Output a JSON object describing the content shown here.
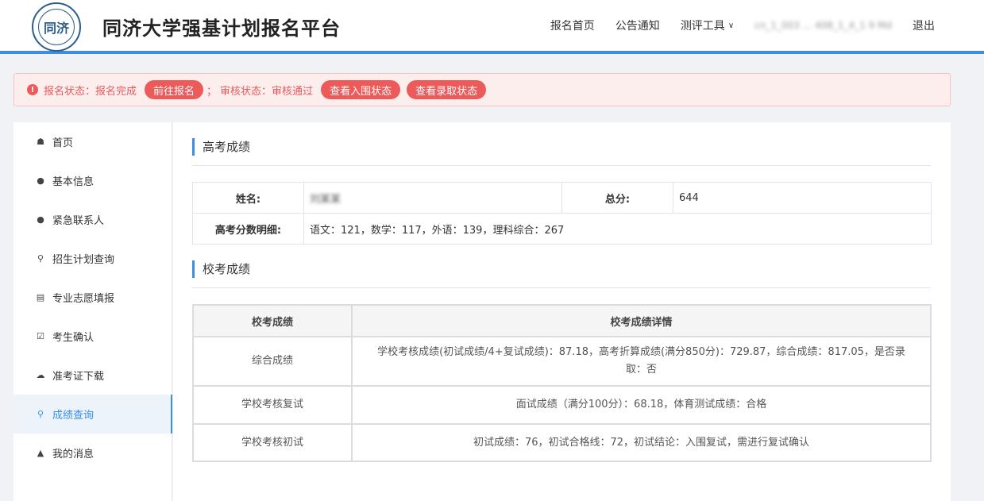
{
  "header": {
    "logo_text": "同济",
    "title": "同济大学强基计划报名平台",
    "nav": {
      "home": "报名首页",
      "notice": "公告通知",
      "tools": "测评工具",
      "user": "cn_1_003 ... 408_1_4_1 9 Md",
      "logout": "退出"
    }
  },
  "alert": {
    "reg_status": "报名状态：报名完成",
    "goto_reg": "前往报名",
    "separator": "；",
    "review_status": "审核状态：审核通过",
    "view_shortlist": "查看入围状态",
    "view_admission": "查看录取状态"
  },
  "sidebar": {
    "items": [
      {
        "label": "首页",
        "icon": "home-icon"
      },
      {
        "label": "基本信息",
        "icon": "user-icon"
      },
      {
        "label": "紧急联系人",
        "icon": "user-icon"
      },
      {
        "label": "招生计划查询",
        "icon": "search-icon"
      },
      {
        "label": "专业志愿填报",
        "icon": "form-icon"
      },
      {
        "label": "考生确认",
        "icon": "checkbox-icon"
      },
      {
        "label": "准考证下载",
        "icon": "cloud-download-icon"
      },
      {
        "label": "成绩查询",
        "icon": "search-icon",
        "active": true
      },
      {
        "label": "我的消息",
        "icon": "bell-icon"
      }
    ]
  },
  "gaokao": {
    "title": "高考成绩",
    "name_label": "姓名:",
    "name_value": "刘某某",
    "total_label": "总分:",
    "total_value": "644",
    "detail_label": "高考分数明细:",
    "detail_value": "语文：121，数学：117，外语：139，理科综合：267"
  },
  "school": {
    "title": "校考成绩",
    "headers": [
      "校考成绩",
      "校考成绩详情"
    ],
    "rows": [
      {
        "name": "综合成绩",
        "detail": "学校考核成绩(初试成绩/4+复试成绩)：87.18，高考折算成绩(满分850分)：729.87，综合成绩：817.05，是否录取：否"
      },
      {
        "name": "学校考核复试",
        "detail": "面试成绩（满分100分）：68.18，体育测试成绩：合格"
      },
      {
        "name": "学校考核初试",
        "detail": "初试成绩：76，初试合格线：72，初试结论：入围复试，需进行复试确认"
      }
    ]
  },
  "colors": {
    "accent": "#3a8ee6",
    "alert_red": "#ec5a5a"
  }
}
